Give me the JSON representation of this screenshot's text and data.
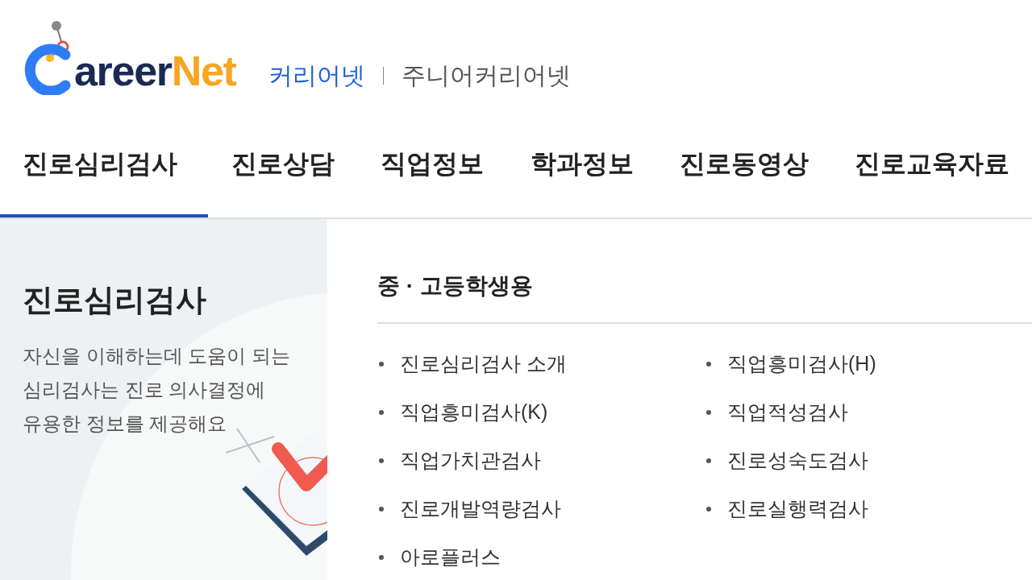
{
  "logo": {
    "wordmark": "areer",
    "accent": "Net"
  },
  "site_links": [
    {
      "label": "커리어넷",
      "selected": true
    },
    {
      "label": "주니어커리어넷",
      "selected": false
    }
  ],
  "tabs": [
    {
      "label": "진로심리검사",
      "selected": true
    },
    {
      "label": "진로상담",
      "selected": false
    },
    {
      "label": "직업정보",
      "selected": false
    },
    {
      "label": "학과정보",
      "selected": false
    },
    {
      "label": "진로동영상",
      "selected": false
    },
    {
      "label": "진로교육자료",
      "selected": false
    }
  ],
  "intro": {
    "title": "진로심리검사",
    "description": "자신을 이해하는데 도움이 되는\n심리검사는 진로 의사결정에\n유용한 정보를 제공해요"
  },
  "menu": {
    "heading": "중 · 고등학생용",
    "columns": [
      [
        "진로심리검사 소개",
        "직업흥미검사(K)",
        "직업가치관검사",
        "진로개발역량검사",
        "아로플러스"
      ],
      [
        "직업흥미검사(H)",
        "직업적성검사",
        "진로성숙도검사",
        "진로실행력검사"
      ]
    ]
  }
}
